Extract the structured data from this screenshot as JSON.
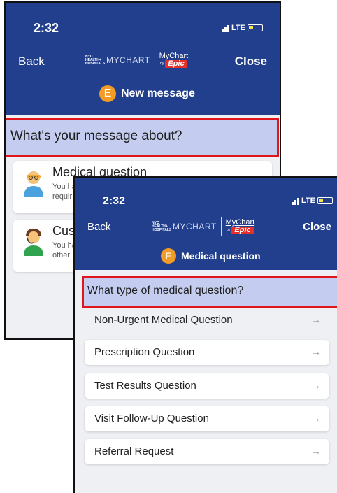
{
  "screen1": {
    "status": {
      "time": "2:32",
      "network": "LTE"
    },
    "nav": {
      "back": "Back",
      "close": "Close"
    },
    "logo": {
      "org": "NYC HEALTH+ HOSPITALS",
      "app": "MYCHART",
      "brand": "MyChart",
      "by": "by",
      "epic": "Epic"
    },
    "title": {
      "badge": "E",
      "text": "New message"
    },
    "question": "What's your message about?",
    "options": [
      {
        "title": "Medical question",
        "subtitle": "You ha",
        "subtitle2": "requir",
        "icon": "doctor-icon"
      },
      {
        "title": "Cust",
        "subtitle": "You ha",
        "subtitle2": "other",
        "icon": "support-agent-icon"
      }
    ]
  },
  "screen2": {
    "status": {
      "time": "2:32",
      "network": "LTE"
    },
    "nav": {
      "back": "Back",
      "close": "Close"
    },
    "logo": {
      "org": "NYC HEALTH+ HOSPITALS",
      "app": "MYCHART",
      "brand": "MyChart",
      "by": "by",
      "epic": "Epic"
    },
    "title": {
      "badge": "E",
      "text": "Medical question"
    },
    "question": "What type of medical question?",
    "options": [
      {
        "label": "Non-Urgent Medical Question",
        "arrow": "→"
      },
      {
        "label": "Prescription Question",
        "arrow": "→"
      },
      {
        "label": "Test Results Question",
        "arrow": "→"
      },
      {
        "label": "Visit Follow-Up Question",
        "arrow": "→"
      },
      {
        "label": "Referral Request",
        "arrow": "→"
      }
    ]
  },
  "colors": {
    "header": "#213f8c",
    "highlight": "#c4cdf0",
    "outline": "#e0161b",
    "badge": "#f39c25",
    "epic": "#e4302a"
  }
}
